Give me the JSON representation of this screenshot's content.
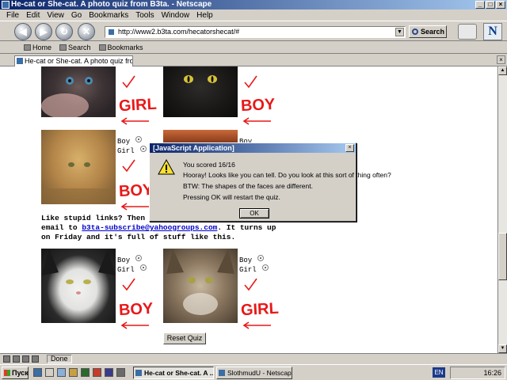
{
  "window": {
    "title": "He-cat or She-cat. A photo quiz from B3ta. - Netscape"
  },
  "menu": [
    "File",
    "Edit",
    "View",
    "Go",
    "Bookmarks",
    "Tools",
    "Window",
    "Help"
  ],
  "navbar": {
    "url": "http://www2.b3ta.com/hecatorshecat/#",
    "search_label": "Search"
  },
  "personal_toolbar": {
    "home": "Home",
    "search": "Search",
    "bookmarks": "Bookmarks"
  },
  "tab": {
    "label": "He-cat or She-cat. A photo quiz from B3ta."
  },
  "quiz": {
    "boy": "Boy",
    "girl": "Girl",
    "answers": [
      "GIRL",
      "BOY",
      "BOY",
      "BOY",
      "GIRL"
    ],
    "link_text_before": "Like stupid links? Then get",
    "link_text_email_prefix": "email to ",
    "link_email": "b3ta-subscribe@yahoogroups.com",
    "link_text_after": ". It turns up on Friday and it's full of stuff like this.",
    "reset_label": "Reset Quiz"
  },
  "dialog": {
    "title": "[JavaScript Application]",
    "line1": "You scored 16/16",
    "line2": "Hooray! Looks like you can tell. Do you look at this sort of thing often?",
    "line3": "BTW: The shapes of the faces are different.",
    "line4": "Pressing OK will restart the quiz.",
    "ok_label": "OK"
  },
  "status": {
    "text": "Done"
  },
  "taskbar": {
    "start": "Пуск",
    "task1": "He-cat or She-cat. A ...",
    "task2": "SlothmudU - Netscape",
    "lang": "EN",
    "time": "16:26"
  },
  "colors": {
    "answer_red": "#e81818",
    "title_blue": "#0a246a",
    "link_blue": "#0000cc"
  }
}
